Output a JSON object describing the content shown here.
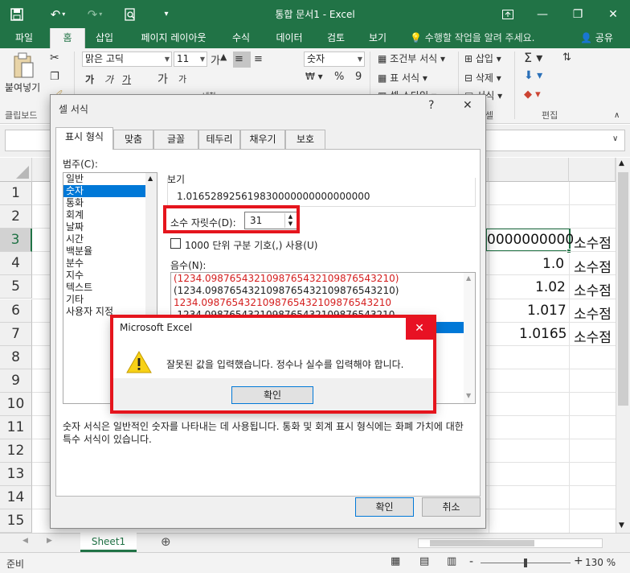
{
  "titlebar": {
    "title": "통합 문서1 - Excel",
    "save_icon": "save-icon",
    "undo_icon": "undo-icon",
    "redo_icon": "redo-icon",
    "preview_icon": "print-preview-icon",
    "customize_icon": "customize-qat-icon"
  },
  "tabs": {
    "file": "파일",
    "home": "홈",
    "insert": "삽입",
    "page_layout": "페이지 레이아웃",
    "formulas": "수식",
    "data": "데이터",
    "review": "검토",
    "view": "보기",
    "tell_me": "수행할 작업을 알려 주세요.",
    "share": "공유"
  },
  "ribbon": {
    "paste": "붙여넣기",
    "clipboard": "클립보드",
    "font_name": "맑은 고딕",
    "font_size": "11",
    "bold": "가",
    "italic": "가",
    "underline": "가",
    "grow": "가",
    "shrink": "가",
    "phonetic": "내천",
    "number_format": "숫자",
    "percent": "%",
    "comma": "9",
    "conditional": "조건부 서식",
    "table_format": "표 서식",
    "cell_styles": "셀 스타일",
    "insert": "삽입",
    "delete": "삭제",
    "format": "서식",
    "editing": "편집",
    "cells_group": "셀"
  },
  "grid": {
    "rows": [
      "1",
      "2",
      "3",
      "4",
      "5",
      "6",
      "7",
      "8",
      "9",
      "10",
      "11",
      "12",
      "13",
      "14",
      "15"
    ],
    "selected_row": "3",
    "cells": {
      "r3_value": "0000000000",
      "r3_text": "소수점",
      "r4_value": "1.0",
      "r4_text": "소수점",
      "r5_value": "1.02",
      "r5_text": "소수점",
      "r6_value": "1.017",
      "r6_text": "소수점",
      "r7_value": "1.0165",
      "r7_text": "소수점"
    }
  },
  "sheetbar": {
    "sheet1": "Sheet1",
    "add_sheet": "⊕"
  },
  "statusbar": {
    "ready": "준비",
    "zoom": "130 %",
    "zoom_out": "-",
    "zoom_in": "+"
  },
  "dialog": {
    "title": "셀 서식",
    "help": "?",
    "close": "✕",
    "tabs": [
      "표시 형식",
      "맞춤",
      "글꼴",
      "테두리",
      "채우기",
      "보호"
    ],
    "category_label": "범주(C):",
    "categories": [
      "일반",
      "숫자",
      "통화",
      "회계",
      "날짜",
      "시간",
      "백분율",
      "분수",
      "지수",
      "텍스트",
      "기타",
      "사용자 지정"
    ],
    "selected_category": "숫자",
    "sample_label": "보기",
    "sample_value": "1.016528925619830000000000000000",
    "decimal_label": "소수 자릿수(D):",
    "decimal_value": "31",
    "thousands_label": "1000 단위 구분 기호(,) 사용(U)",
    "negative_label": "음수(N):",
    "negative_items": [
      "(1234.0987654321098765432109876543210)",
      "(1234.0987654321098765432109876543210)",
      "1234.0987654321098765432109876543210",
      "-1234.0987654321098765432109876543210"
    ],
    "description": "숫자 서식은 일반적인 숫자를 나타내는 데 사용됩니다. 통화 및 회계 표시 형식에는 화폐 가치에 대한 특수 서식이 있습니다.",
    "ok": "확인",
    "cancel": "취소"
  },
  "msgbox": {
    "title": "Microsoft Excel",
    "message": "잘못된 값을 입력했습니다. 정수나 실수를 입력해야 합니다.",
    "ok": "확인",
    "close": "✕",
    "icon": "warning-icon"
  },
  "colors": {
    "excel_green": "#217346",
    "highlight_red": "#e5151d",
    "selection_blue": "#0078d7",
    "negative_red": "#d41e1e"
  }
}
